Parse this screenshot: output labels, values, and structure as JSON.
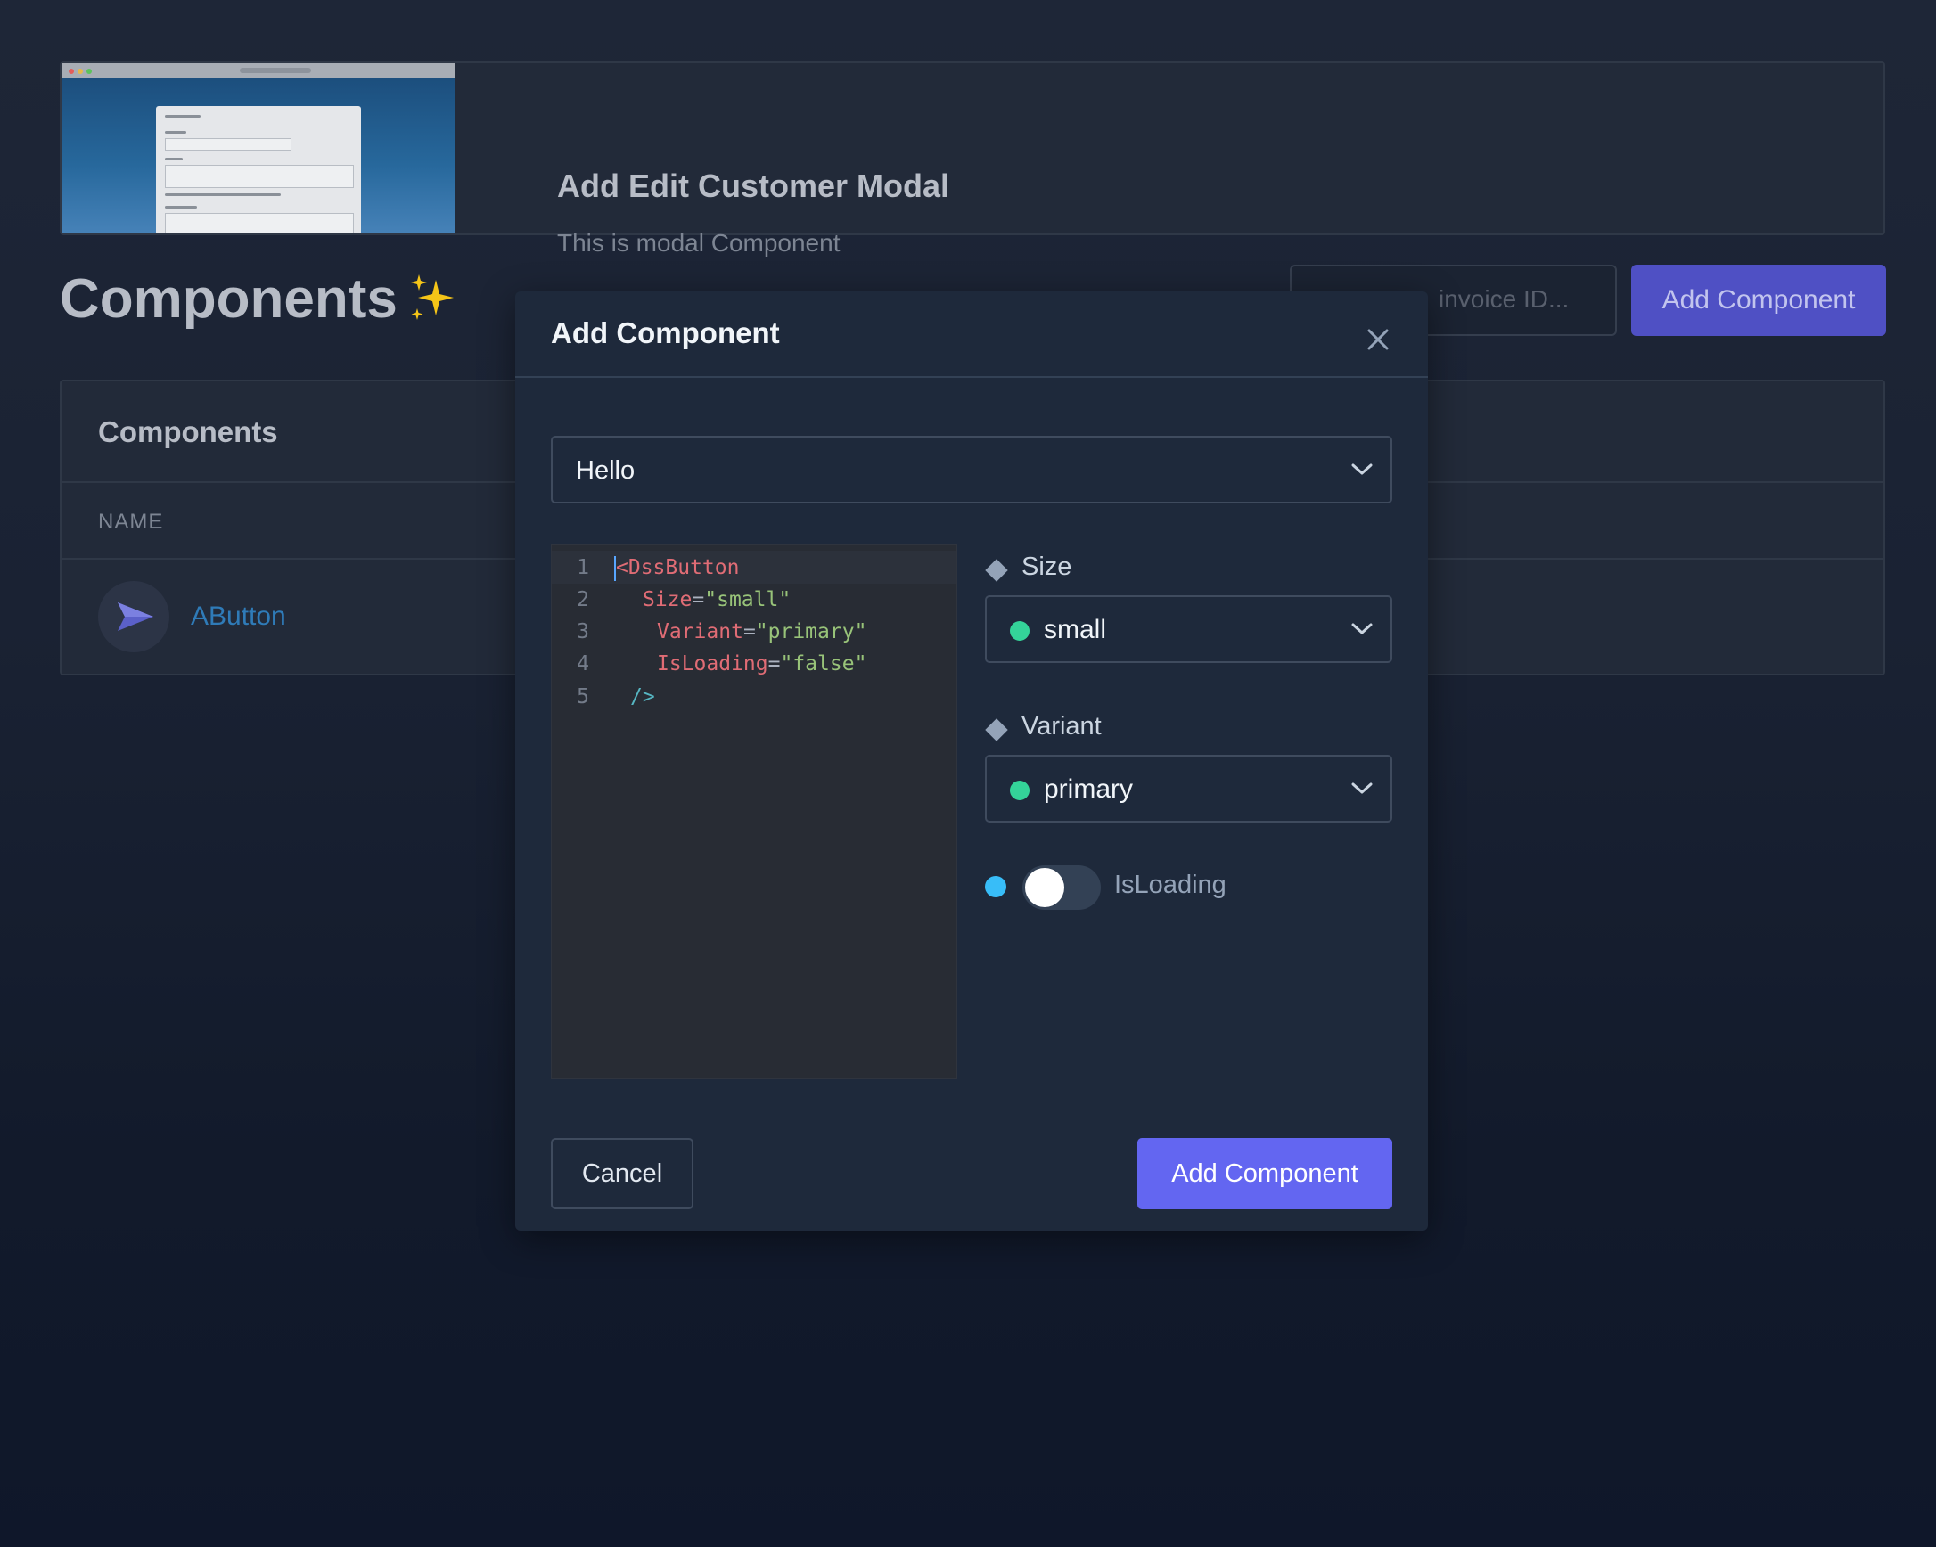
{
  "background": {
    "card": {
      "title": "Add Edit Customer Modal",
      "subtitle": "This is modal Component"
    },
    "page_title": "Components",
    "search": {
      "visible_text": "invoice ID..."
    },
    "add_button_label": "Add Component",
    "table": {
      "title": "Components",
      "column_name": "NAME",
      "rows": [
        {
          "name": "AButton",
          "icon": "send-icon"
        }
      ]
    }
  },
  "modal": {
    "title": "Add Component",
    "component_select": {
      "value": "Hello"
    },
    "code": {
      "line_numbers": [
        "1",
        "2",
        "3",
        "4",
        "5"
      ],
      "tag_open": "<DssButton",
      "attrs": [
        {
          "name": "Size",
          "eq": "=",
          "value": "\"small\""
        },
        {
          "name": "Variant",
          "eq": "=",
          "value": "\"primary\""
        },
        {
          "name": "IsLoading",
          "eq": "=",
          "value": "\"false\""
        }
      ],
      "tag_close": "/>"
    },
    "props": {
      "size": {
        "label": "Size",
        "value": "small"
      },
      "variant": {
        "label": "Variant",
        "value": "primary"
      },
      "is_loading": {
        "label": "IsLoading",
        "checked": false
      }
    },
    "cancel_label": "Cancel",
    "submit_label": "Add Component"
  },
  "colors": {
    "accent": "#6366f1",
    "status_green": "#34d399",
    "status_blue": "#38bdf8",
    "modal_bg": "#1e293b"
  }
}
